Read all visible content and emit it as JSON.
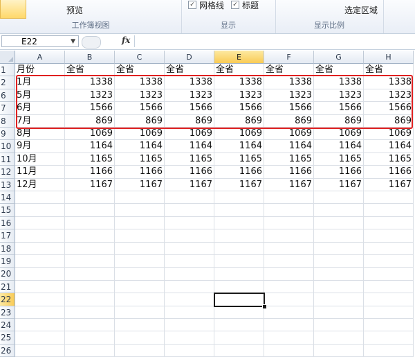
{
  "ribbon": {
    "groups": [
      {
        "label": "工作簿视图",
        "items": [
          {
            "label": "预览"
          }
        ]
      },
      {
        "label": "显示",
        "items": [
          {
            "label": "网格线",
            "checked": true
          },
          {
            "label": "标题",
            "checked": true
          }
        ]
      },
      {
        "label": "显示比例",
        "items": [
          {
            "label": "选定区域"
          }
        ]
      }
    ]
  },
  "formula_bar": {
    "name_box": "E22",
    "fx_label": "fx",
    "value": ""
  },
  "sheet": {
    "column_headers": [
      "A",
      "B",
      "C",
      "D",
      "E",
      "F",
      "G",
      "H"
    ],
    "active_column": "E",
    "active_row": "22",
    "rows": [
      {
        "num": "1",
        "cells": [
          "月份",
          "全省",
          "全省",
          "全省",
          "全省",
          "全省",
          "全省",
          "全省"
        ]
      },
      {
        "num": "2",
        "cells": [
          "1月",
          "1338",
          "1338",
          "1338",
          "1338",
          "1338",
          "1338",
          "1338"
        ]
      },
      {
        "num": "6",
        "cells": [
          "5月",
          "1323",
          "1323",
          "1323",
          "1323",
          "1323",
          "1323",
          "1323"
        ]
      },
      {
        "num": "7",
        "cells": [
          "6月",
          "1566",
          "1566",
          "1566",
          "1566",
          "1566",
          "1566",
          "1566"
        ]
      },
      {
        "num": "8",
        "cells": [
          "7月",
          "869",
          "869",
          "869",
          "869",
          "869",
          "869",
          "869"
        ]
      },
      {
        "num": "9",
        "cells": [
          "8月",
          "1069",
          "1069",
          "1069",
          "1069",
          "1069",
          "1069",
          "1069"
        ]
      },
      {
        "num": "10",
        "cells": [
          "9月",
          "1164",
          "1164",
          "1164",
          "1164",
          "1164",
          "1164",
          "1164"
        ]
      },
      {
        "num": "11",
        "cells": [
          "10月",
          "1165",
          "1165",
          "1165",
          "1165",
          "1165",
          "1165",
          "1165"
        ]
      },
      {
        "num": "12",
        "cells": [
          "11月",
          "1166",
          "1166",
          "1166",
          "1166",
          "1166",
          "1166",
          "1166"
        ]
      },
      {
        "num": "13",
        "cells": [
          "12月",
          "1167",
          "1167",
          "1167",
          "1167",
          "1167",
          "1167",
          "1167"
        ]
      },
      {
        "num": "14",
        "cells": [
          "",
          "",
          "",
          "",
          "",
          "",
          "",
          ""
        ]
      },
      {
        "num": "15",
        "cells": [
          "",
          "",
          "",
          "",
          "",
          "",
          "",
          ""
        ]
      },
      {
        "num": "16",
        "cells": [
          "",
          "",
          "",
          "",
          "",
          "",
          "",
          ""
        ]
      },
      {
        "num": "17",
        "cells": [
          "",
          "",
          "",
          "",
          "",
          "",
          "",
          ""
        ]
      },
      {
        "num": "18",
        "cells": [
          "",
          "",
          "",
          "",
          "",
          "",
          "",
          ""
        ]
      },
      {
        "num": "19",
        "cells": [
          "",
          "",
          "",
          "",
          "",
          "",
          "",
          ""
        ]
      },
      {
        "num": "20",
        "cells": [
          "",
          "",
          "",
          "",
          "",
          "",
          "",
          ""
        ]
      },
      {
        "num": "21",
        "cells": [
          "",
          "",
          "",
          "",
          "",
          "",
          "",
          ""
        ]
      },
      {
        "num": "22",
        "cells": [
          "",
          "",
          "",
          "",
          "",
          "",
          "",
          ""
        ]
      },
      {
        "num": "23",
        "cells": [
          "",
          "",
          "",
          "",
          "",
          "",
          "",
          ""
        ]
      },
      {
        "num": "24",
        "cells": [
          "",
          "",
          "",
          "",
          "",
          "",
          "",
          ""
        ]
      },
      {
        "num": "25",
        "cells": [
          "",
          "",
          "",
          "",
          "",
          "",
          "",
          ""
        ]
      },
      {
        "num": "26",
        "cells": [
          "",
          "",
          "",
          "",
          "",
          "",
          "",
          ""
        ]
      }
    ]
  },
  "colors": {
    "highlight_border": "#e02020",
    "active_header": "#f9cb55"
  }
}
